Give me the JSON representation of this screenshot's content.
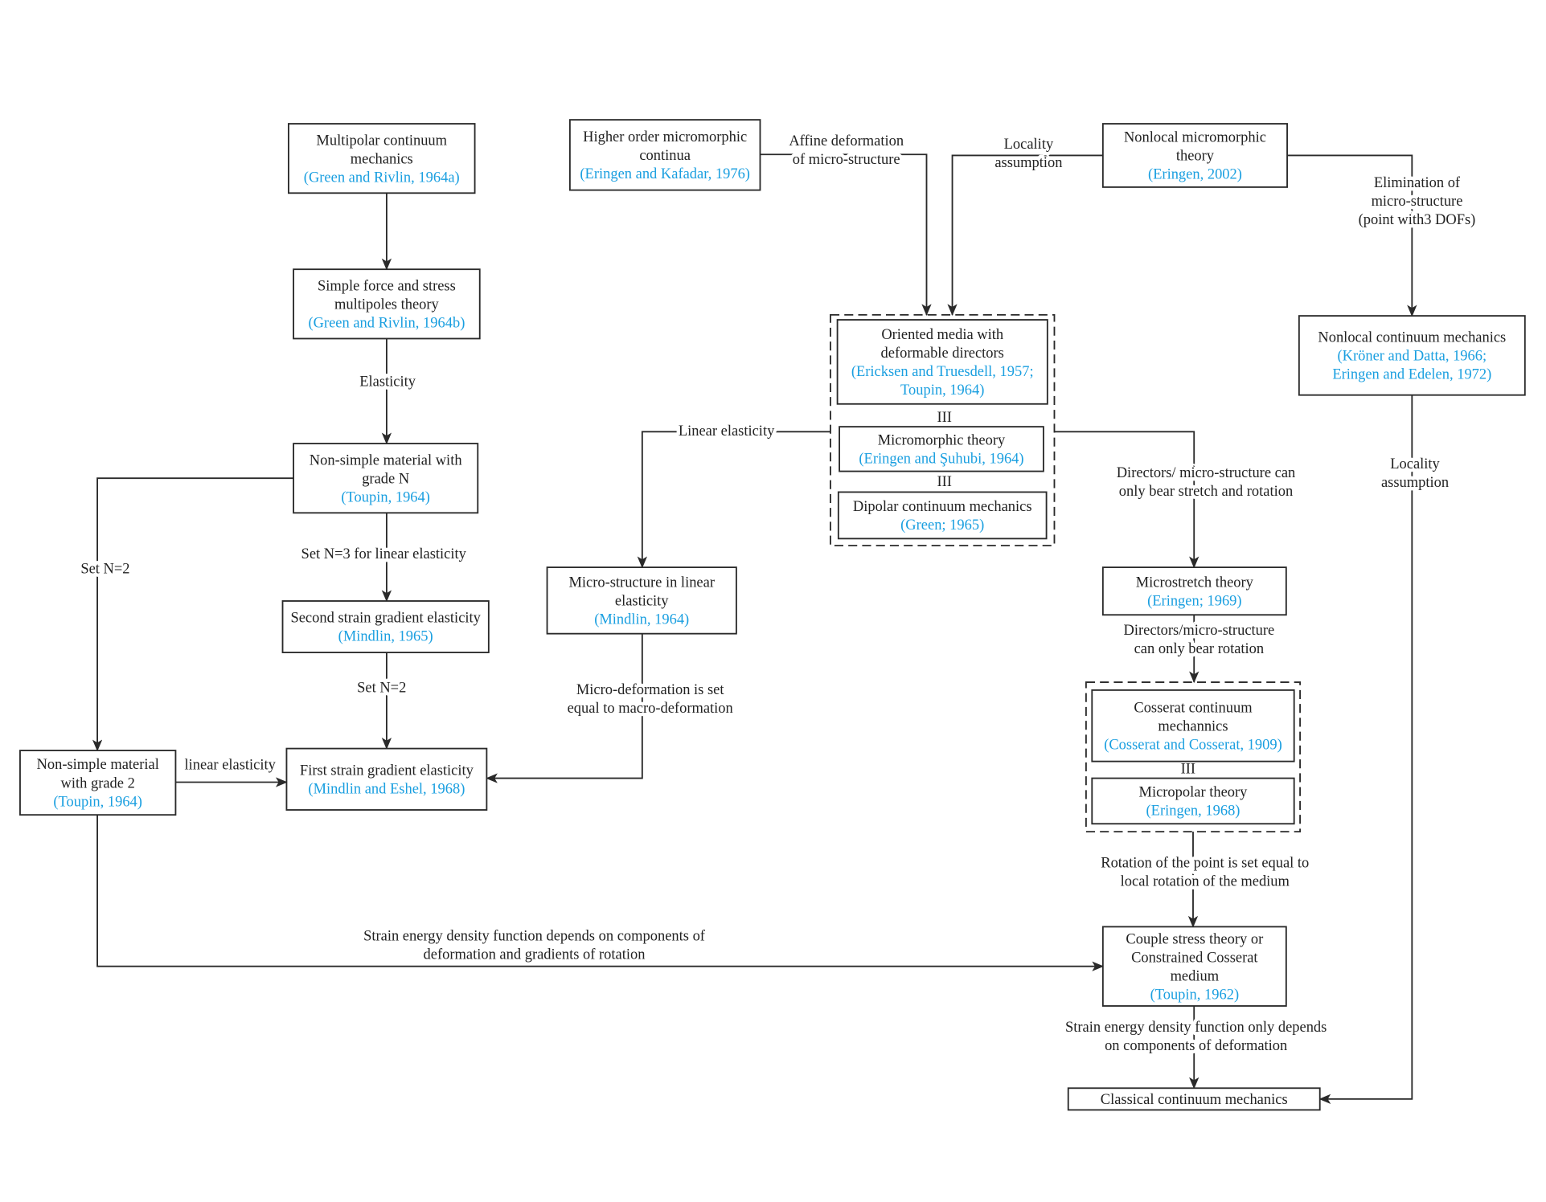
{
  "colors": {
    "text": "#222222",
    "citation": "#1a9fe0",
    "line": "#2a2a2a",
    "background": "#ffffff"
  },
  "equivalence_symbol": "III",
  "nodes": {
    "multipolar": {
      "title": [
        "Multipolar continuum",
        "mechanics"
      ],
      "cite": [
        "(Green and Rivlin, 1964a)"
      ]
    },
    "simple_force": {
      "title": [
        "Simple force and stress",
        "multipoles theory"
      ],
      "cite": [
        "(Green and Rivlin, 1964b)"
      ]
    },
    "nonsimple_n": {
      "title": [
        "Non-simple material with",
        "grade N"
      ],
      "cite": [
        "(Toupin, 1964)"
      ]
    },
    "second_strain": {
      "title": [
        "Second strain gradient elasticity"
      ],
      "cite": [
        "(Mindlin, 1965)"
      ]
    },
    "first_strain": {
      "title": [
        "First strain gradient elasticity"
      ],
      "cite": [
        "(Mindlin and Eshel, 1968)"
      ]
    },
    "nonsimple_2": {
      "title": [
        "Non-simple material",
        "with grade 2"
      ],
      "cite": [
        "(Toupin, 1964)"
      ]
    },
    "higher_order": {
      "title": [
        "Higher order micromorphic",
        "continua"
      ],
      "cite": [
        "(Eringen and Kafadar, 1976)"
      ]
    },
    "nonlocal_micro": {
      "title": [
        "Nonlocal micromorphic",
        "theory"
      ],
      "cite": [
        "(Eringen, 2002)"
      ]
    },
    "oriented": {
      "title": [
        "Oriented media with",
        "deformable directors"
      ],
      "cite": [
        "(Ericksen and Truesdell, 1957;",
        "Toupin, 1964)"
      ]
    },
    "micromorphic": {
      "title": [
        "Micromorphic theory"
      ],
      "cite": [
        "(Eringen and Şuhubi, 1964)"
      ]
    },
    "dipolar": {
      "title": [
        "Dipolar continuum mechanics"
      ],
      "cite": [
        "(Green; 1965)"
      ]
    },
    "micro_linear": {
      "title": [
        "Micro-structure in linear",
        "elasticity"
      ],
      "cite": [
        "(Mindlin, 1964)"
      ]
    },
    "microstretch": {
      "title": [
        "Microstretch theory"
      ],
      "cite": [
        "(Eringen; 1969)"
      ]
    },
    "cosserat": {
      "title": [
        "Cosserat continuum",
        "mechannics"
      ],
      "cite": [
        "(Cosserat and Cosserat, 1909)"
      ]
    },
    "micropolar": {
      "title": [
        "Micropolar theory"
      ],
      "cite": [
        "(Eringen, 1968)"
      ]
    },
    "couple": {
      "title": [
        "Couple stress theory or",
        "Constrained Cosserat",
        "medium"
      ],
      "cite": [
        "(Toupin, 1962)"
      ]
    },
    "classical": {
      "title": [
        "Classical continuum mechanics"
      ],
      "cite": []
    },
    "nonlocal_cont": {
      "title": [
        "Nonlocal continuum mechanics"
      ],
      "cite": [
        "(Kröner and Datta, 1966;",
        "Eringen and Edelen, 1972)"
      ]
    }
  },
  "edges": [
    {
      "from": "multipolar",
      "to": "simple_force",
      "label": []
    },
    {
      "from": "simple_force",
      "to": "nonsimple_n",
      "label": [
        "Elasticity"
      ]
    },
    {
      "from": "nonsimple_n",
      "to": "second_strain",
      "label": [
        "Set N=3 for linear elasticity"
      ]
    },
    {
      "from": "second_strain",
      "to": "first_strain",
      "label": [
        "Set N=2"
      ]
    },
    {
      "from": "nonsimple_n",
      "to": "nonsimple_2",
      "label": [
        "Set N=2"
      ]
    },
    {
      "from": "nonsimple_2",
      "to": "first_strain",
      "label": [
        "linear elasticity"
      ]
    },
    {
      "from": "micro_linear",
      "to": "first_strain",
      "label": [
        "Micro-deformation is set",
        "equal to macro-deformation"
      ]
    },
    {
      "from": "micromorphic_group",
      "to": "micro_linear",
      "label": [
        "Linear elasticity"
      ]
    },
    {
      "from": "higher_order",
      "to": "micromorphic_group",
      "label": [
        "Affine deformation",
        "of micro-structure"
      ]
    },
    {
      "from": "nonlocal_micro",
      "to": "micromorphic_group",
      "label": [
        "Locality",
        "assumption"
      ]
    },
    {
      "from": "nonlocal_micro",
      "to": "nonlocal_cont",
      "label": [
        "Elimination of",
        "micro-structure",
        "(point with3 DOFs)"
      ]
    },
    {
      "from": "micromorphic_group",
      "to": "microstretch",
      "label": [
        "Directors/ micro-structure can",
        "only bear stretch and rotation"
      ]
    },
    {
      "from": "microstretch",
      "to": "cosserat_group",
      "label": [
        "Directors/micro-structure",
        "can only bear rotation"
      ]
    },
    {
      "from": "cosserat_group",
      "to": "couple",
      "label": [
        "Rotation of the point is set equal to",
        "local rotation of the medium"
      ]
    },
    {
      "from": "nonsimple_2",
      "to": "couple",
      "label": [
        "Strain energy density function depends on components of",
        "deformation and gradients of rotation"
      ]
    },
    {
      "from": "couple",
      "to": "classical",
      "label": [
        "Strain energy density function only depends",
        "on components of deformation"
      ]
    },
    {
      "from": "nonlocal_cont",
      "to": "classical",
      "label": [
        "Locality",
        "assumption"
      ]
    }
  ]
}
